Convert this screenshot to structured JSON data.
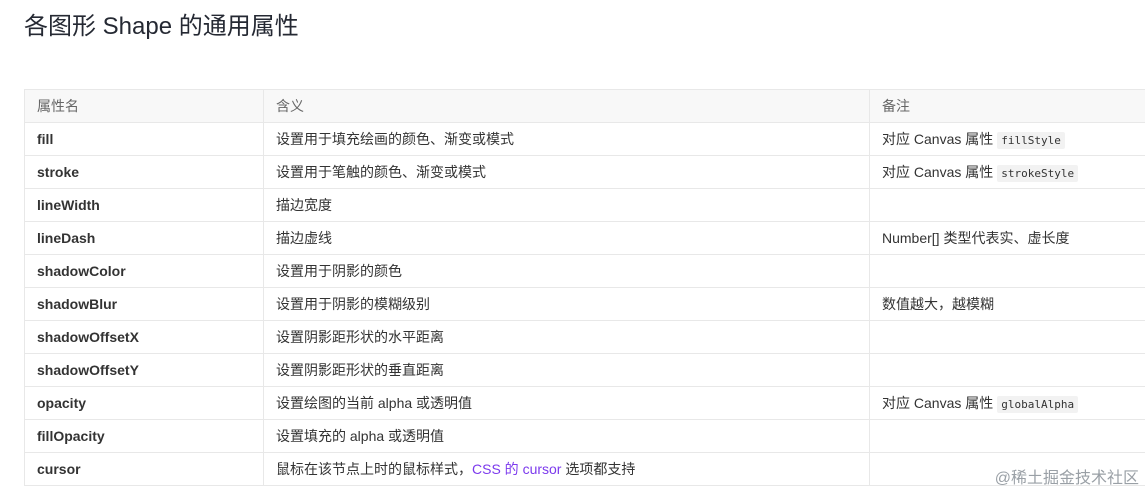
{
  "heading": "各图形 Shape 的通用属性",
  "table": {
    "headers": [
      "属性名",
      "含义",
      "备注"
    ],
    "rows": [
      {
        "name": "fill",
        "desc": "设置用于填充绘画的颜色、渐变或模式",
        "note": "对应 Canvas 属性",
        "code": "fillStyle"
      },
      {
        "name": "stroke",
        "desc": "设置用于笔触的颜色、渐变或模式",
        "note": "对应 Canvas 属性",
        "code": "strokeStyle"
      },
      {
        "name": "lineWidth",
        "desc": "描边宽度",
        "note": "",
        "code": ""
      },
      {
        "name": "lineDash",
        "desc": "描边虚线",
        "note": "Number[] 类型代表实、虚长度",
        "code": ""
      },
      {
        "name": "shadowColor",
        "desc": "设置用于阴影的颜色",
        "note": "",
        "code": ""
      },
      {
        "name": "shadowBlur",
        "desc": "设置用于阴影的模糊级别",
        "note": "数值越大，越模糊",
        "code": ""
      },
      {
        "name": "shadowOffsetX",
        "desc": "设置阴影距形状的水平距离",
        "note": "",
        "code": ""
      },
      {
        "name": "shadowOffsetY",
        "desc": "设置阴影距形状的垂直距离",
        "note": "",
        "code": ""
      },
      {
        "name": "opacity",
        "desc": "设置绘图的当前 alpha 或透明值",
        "note": "对应 Canvas 属性",
        "code": "globalAlpha"
      },
      {
        "name": "fillOpacity",
        "desc": "设置填充的 alpha 或透明值",
        "note": "",
        "code": ""
      },
      {
        "name": "cursor",
        "desc_before": "鼠标在该节点上时的鼠标样式，",
        "desc_link": "CSS 的 cursor",
        "desc_after": " 选项都支持",
        "note": "",
        "code": ""
      }
    ]
  },
  "watermark": "@稀土掘金技术社区",
  "colors": {
    "link": "#7c3aed",
    "header_bg": "#f8f8f8",
    "border": "#e8e8e8"
  }
}
